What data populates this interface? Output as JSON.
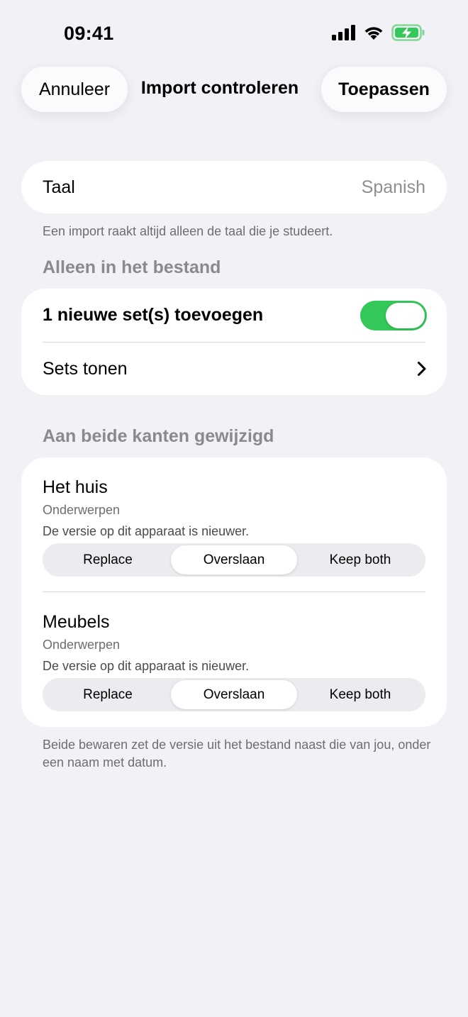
{
  "status": {
    "time": "09:41"
  },
  "nav": {
    "cancel": "Annuleer",
    "title": "Import controleren",
    "apply": "Toepassen"
  },
  "language": {
    "label": "Taal",
    "value": "Spanish",
    "footnote": "Een import raakt altijd alleen de taal die je studeert."
  },
  "file_only": {
    "header": "Alleen in het bestand",
    "add_label": "1 nieuwe set(s) toevoegen",
    "add_enabled": true,
    "show_label": "Sets tonen"
  },
  "conflicts": {
    "header": "Aan beide kanten gewijzigd",
    "items": [
      {
        "title": "Het huis",
        "type": "Onderwerpen",
        "note": "De versie op dit apparaat is nieuwer.",
        "options": [
          "Replace",
          "Overslaan",
          "Keep both"
        ],
        "selected": "Overslaan"
      },
      {
        "title": "Meubels",
        "type": "Onderwerpen",
        "note": "De versie op dit apparaat is nieuwer.",
        "options": [
          "Replace",
          "Overslaan",
          "Keep both"
        ],
        "selected": "Overslaan"
      }
    ],
    "footnote": "Beide bewaren zet de versie uit het bestand naast die van jou, onder een naam met datum."
  },
  "colors": {
    "background": "#f2f1f6",
    "toggle_on": "#34c759",
    "battery": "#34c759"
  }
}
